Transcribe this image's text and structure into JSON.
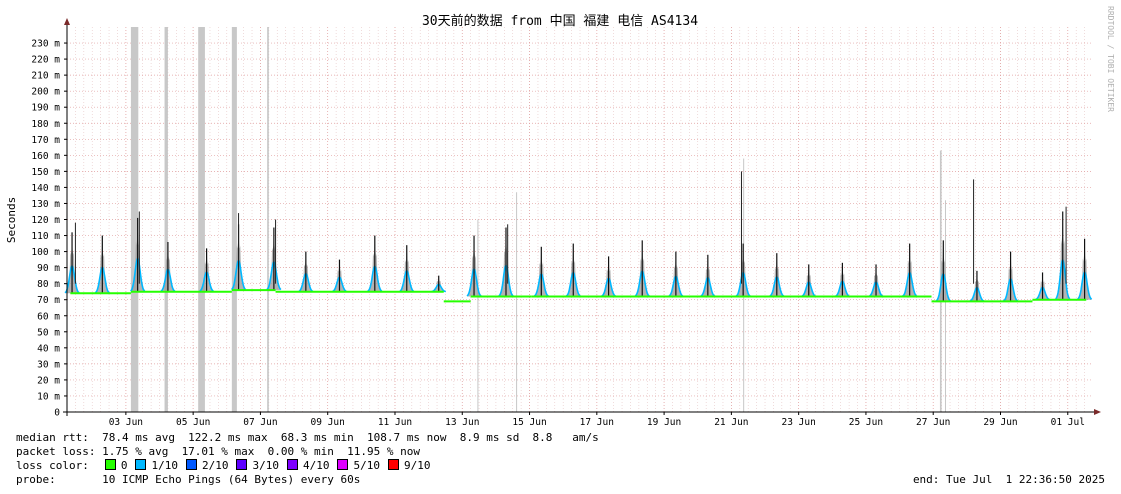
{
  "chart_data": {
    "type": "area",
    "title": "30天前的数据 from 中国 福建 电信 AS4134",
    "watermark": "RRDTOOL / TOBI OETIKER",
    "ylabel": "Seconds",
    "ylim": [
      0,
      240
    ],
    "y_ticks": [
      {
        "value": 0,
        "label": "0"
      },
      {
        "value": 10,
        "label": "10 m"
      },
      {
        "value": 20,
        "label": "20 m"
      },
      {
        "value": 30,
        "label": "30 m"
      },
      {
        "value": 40,
        "label": "40 m"
      },
      {
        "value": 50,
        "label": "50 m"
      },
      {
        "value": 60,
        "label": "60 m"
      },
      {
        "value": 70,
        "label": "70 m"
      },
      {
        "value": 80,
        "label": "80 m"
      },
      {
        "value": 90,
        "label": "90 m"
      },
      {
        "value": 100,
        "label": "100 m"
      },
      {
        "value": 110,
        "label": "110 m"
      },
      {
        "value": 120,
        "label": "120 m"
      },
      {
        "value": 130,
        "label": "130 m"
      },
      {
        "value": 140,
        "label": "140 m"
      },
      {
        "value": 150,
        "label": "150 m"
      },
      {
        "value": 160,
        "label": "160 m"
      },
      {
        "value": 170,
        "label": "170 m"
      },
      {
        "value": 180,
        "label": "180 m"
      },
      {
        "value": 190,
        "label": "190 m"
      },
      {
        "value": 200,
        "label": "200 m"
      },
      {
        "value": 210,
        "label": "210 m"
      },
      {
        "value": 220,
        "label": "220 m"
      },
      {
        "value": 230,
        "label": "230 m"
      }
    ],
    "x_domain_days": [
      0,
      30.5
    ],
    "x_ticks": [
      {
        "day": 1.75,
        "label": "03 Jun"
      },
      {
        "day": 3.75,
        "label": "05 Jun"
      },
      {
        "day": 5.75,
        "label": "07 Jun"
      },
      {
        "day": 7.75,
        "label": "09 Jun"
      },
      {
        "day": 9.75,
        "label": "11 Jun"
      },
      {
        "day": 11.75,
        "label": "13 Jun"
      },
      {
        "day": 13.75,
        "label": "15 Jun"
      },
      {
        "day": 15.75,
        "label": "17 Jun"
      },
      {
        "day": 17.75,
        "label": "19 Jun"
      },
      {
        "day": 19.75,
        "label": "21 Jun"
      },
      {
        "day": 21.75,
        "label": "23 Jun"
      },
      {
        "day": 23.75,
        "label": "25 Jun"
      },
      {
        "day": 25.75,
        "label": "27 Jun"
      },
      {
        "day": 27.75,
        "label": "29 Jun"
      },
      {
        "day": 29.75,
        "label": "01 Jul"
      }
    ],
    "baseline_segments": [
      {
        "from": 0.1,
        "to": 1.9,
        "y": 74
      },
      {
        "from": 1.9,
        "to": 2.9,
        "y": 75
      },
      {
        "from": 2.9,
        "to": 4.0,
        "y": 75
      },
      {
        "from": 4.0,
        "to": 4.9,
        "y": 75
      },
      {
        "from": 4.9,
        "to": 6.2,
        "y": 76
      },
      {
        "from": 6.2,
        "to": 11.2,
        "y": 75
      },
      {
        "from": 11.2,
        "to": 12.0,
        "y": 69
      },
      {
        "from": 12.0,
        "to": 13.8,
        "y": 72
      },
      {
        "from": 13.8,
        "to": 14.7,
        "y": 72
      },
      {
        "from": 14.7,
        "to": 20.0,
        "y": 72
      },
      {
        "from": 20.0,
        "to": 25.7,
        "y": 72
      },
      {
        "from": 25.7,
        "to": 28.7,
        "y": 69
      },
      {
        "from": 28.7,
        "to": 30.3,
        "y": 70
      }
    ],
    "daily_peaks": [
      {
        "day": 0.15,
        "y": 112
      },
      {
        "day": 1.05,
        "y": 110
      },
      {
        "day": 2.1,
        "y": 121
      },
      {
        "day": 3.0,
        "y": 106
      },
      {
        "day": 4.15,
        "y": 102
      },
      {
        "day": 5.1,
        "y": 117
      },
      {
        "day": 6.15,
        "y": 115
      },
      {
        "day": 7.1,
        "y": 100
      },
      {
        "day": 8.1,
        "y": 95
      },
      {
        "day": 9.15,
        "y": 110
      },
      {
        "day": 10.1,
        "y": 104
      },
      {
        "day": 11.05,
        "y": 85
      },
      {
        "day": 12.1,
        "y": 110
      },
      {
        "day": 13.05,
        "y": 115
      },
      {
        "day": 14.1,
        "y": 103
      },
      {
        "day": 15.05,
        "y": 105
      },
      {
        "day": 16.1,
        "y": 97
      },
      {
        "day": 17.1,
        "y": 107
      },
      {
        "day": 18.1,
        "y": 100
      },
      {
        "day": 19.05,
        "y": 98
      },
      {
        "day": 20.1,
        "y": 105
      },
      {
        "day": 21.1,
        "y": 99
      },
      {
        "day": 22.05,
        "y": 92
      },
      {
        "day": 23.05,
        "y": 93
      },
      {
        "day": 24.05,
        "y": 92
      },
      {
        "day": 25.05,
        "y": 105
      },
      {
        "day": 26.05,
        "y": 107
      },
      {
        "day": 27.05,
        "y": 88
      },
      {
        "day": 28.05,
        "y": 100
      },
      {
        "day": 29.0,
        "y": 87
      },
      {
        "day": 29.6,
        "y": 125
      },
      {
        "day": 30.25,
        "y": 108
      }
    ],
    "spikes": [
      {
        "day": 0.25,
        "y": 118
      },
      {
        "day": 2.15,
        "y": 125
      },
      {
        "day": 5.1,
        "y": 124
      },
      {
        "day": 6.2,
        "y": 120
      },
      {
        "day": 13.1,
        "y": 117
      },
      {
        "day": 20.05,
        "y": 150
      },
      {
        "day": 26.95,
        "y": 145
      },
      {
        "day": 29.7,
        "y": 128
      }
    ],
    "loss_bars": [
      {
        "day": 1.9,
        "width": 0.22,
        "y": 240
      },
      {
        "day": 2.9,
        "width": 0.1,
        "y": 240
      },
      {
        "day": 3.9,
        "width": 0.2,
        "y": 240
      },
      {
        "day": 4.9,
        "width": 0.15,
        "y": 240
      },
      {
        "day": 5.95,
        "width": 0.05,
        "y": 240
      },
      {
        "day": 12.2,
        "width": 0.03,
        "y": 120
      },
      {
        "day": 13.35,
        "width": 0.03,
        "y": 137
      },
      {
        "day": 20.1,
        "width": 0.03,
        "y": 158
      },
      {
        "day": 25.95,
        "width": 0.05,
        "y": 163
      },
      {
        "day": 26.1,
        "width": 0.03,
        "y": 132
      }
    ],
    "series": [
      {
        "name": "0",
        "color": "#26ff00"
      },
      {
        "name": "1/10",
        "color": "#00b8ff"
      },
      {
        "name": "2/10",
        "color": "#0059ff"
      },
      {
        "name": "3/10",
        "color": "#5e00ff"
      },
      {
        "name": "4/10",
        "color": "#7e00ff"
      },
      {
        "name": "5/10",
        "color": "#dd00ff"
      },
      {
        "name": "9/10",
        "color": "#ff0000"
      }
    ],
    "grid": true
  },
  "stats": {
    "median_rtt": "median rtt:  78.4 ms avg  122.2 ms max  68.3 ms min  108.7 ms now  8.9 ms sd  8.8   am/s",
    "packet_loss": "packet loss: 1.75 % avg  17.01 % max  0.00 % min  11.95 % now",
    "loss_color_label": "loss color:",
    "probe": "probe:       10 ICMP Echo Pings (64 Bytes) every 60s",
    "end": "end: Tue Jul  1 22:36:50 2025"
  }
}
